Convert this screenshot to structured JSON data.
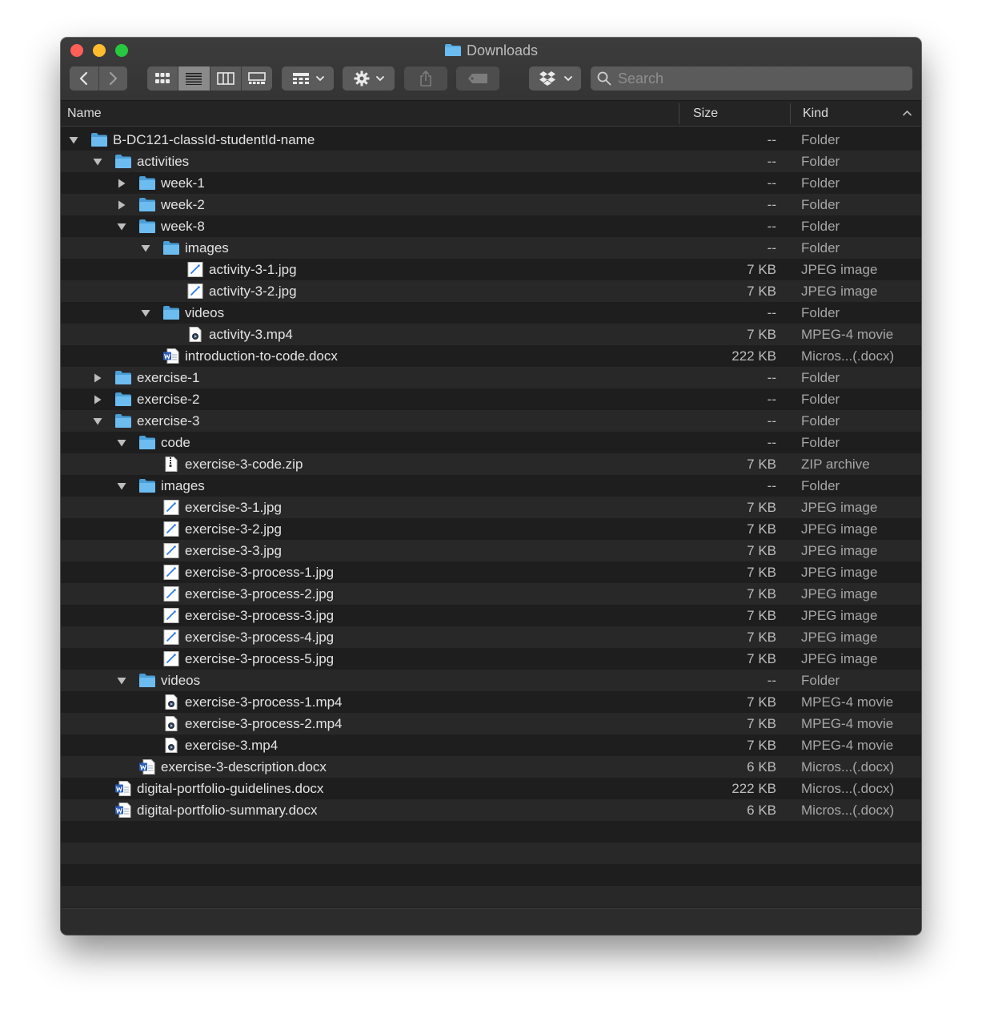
{
  "window": {
    "title": "Downloads"
  },
  "toolbar": {
    "search_placeholder": "Search"
  },
  "columns": {
    "name": "Name",
    "size": "Size",
    "kind": "Kind"
  },
  "rows": [
    {
      "name": "B-DC121-classId-studentId-name",
      "size": "--",
      "kind": "Folder",
      "depth": 0,
      "type": "folder",
      "disclosure": "expanded"
    },
    {
      "name": "activities",
      "size": "--",
      "kind": "Folder",
      "depth": 1,
      "type": "folder",
      "disclosure": "expanded"
    },
    {
      "name": "week-1",
      "size": "--",
      "kind": "Folder",
      "depth": 2,
      "type": "folder",
      "disclosure": "collapsed"
    },
    {
      "name": "week-2",
      "size": "--",
      "kind": "Folder",
      "depth": 2,
      "type": "folder",
      "disclosure": "collapsed"
    },
    {
      "name": "week-8",
      "size": "--",
      "kind": "Folder",
      "depth": 2,
      "type": "folder",
      "disclosure": "expanded"
    },
    {
      "name": "images",
      "size": "--",
      "kind": "Folder",
      "depth": 3,
      "type": "folder",
      "disclosure": "expanded"
    },
    {
      "name": "activity-3-1.jpg",
      "size": "7 KB",
      "kind": "JPEG image",
      "depth": 4,
      "type": "image"
    },
    {
      "name": "activity-3-2.jpg",
      "size": "7 KB",
      "kind": "JPEG image",
      "depth": 4,
      "type": "image"
    },
    {
      "name": "videos",
      "size": "--",
      "kind": "Folder",
      "depth": 3,
      "type": "folder",
      "disclosure": "expanded"
    },
    {
      "name": "activity-3.mp4",
      "size": "7 KB",
      "kind": "MPEG-4 movie",
      "depth": 4,
      "type": "movie"
    },
    {
      "name": "introduction-to-code.docx",
      "size": "222 KB",
      "kind": "Micros...(.docx)",
      "depth": 3,
      "type": "docx"
    },
    {
      "name": "exercise-1",
      "size": "--",
      "kind": "Folder",
      "depth": 1,
      "type": "folder",
      "disclosure": "collapsed"
    },
    {
      "name": "exercise-2",
      "size": "--",
      "kind": "Folder",
      "depth": 1,
      "type": "folder",
      "disclosure": "collapsed"
    },
    {
      "name": "exercise-3",
      "size": "--",
      "kind": "Folder",
      "depth": 1,
      "type": "folder",
      "disclosure": "expanded"
    },
    {
      "name": "code",
      "size": "--",
      "kind": "Folder",
      "depth": 2,
      "type": "folder",
      "disclosure": "expanded"
    },
    {
      "name": "exercise-3-code.zip",
      "size": "7 KB",
      "kind": "ZIP archive",
      "depth": 3,
      "type": "zip"
    },
    {
      "name": "images",
      "size": "--",
      "kind": "Folder",
      "depth": 2,
      "type": "folder",
      "disclosure": "expanded"
    },
    {
      "name": "exercise-3-1.jpg",
      "size": "7 KB",
      "kind": "JPEG image",
      "depth": 3,
      "type": "image"
    },
    {
      "name": "exercise-3-2.jpg",
      "size": "7 KB",
      "kind": "JPEG image",
      "depth": 3,
      "type": "image"
    },
    {
      "name": "exercise-3-3.jpg",
      "size": "7 KB",
      "kind": "JPEG image",
      "depth": 3,
      "type": "image"
    },
    {
      "name": "exercise-3-process-1.jpg",
      "size": "7 KB",
      "kind": "JPEG image",
      "depth": 3,
      "type": "image"
    },
    {
      "name": "exercise-3-process-2.jpg",
      "size": "7 KB",
      "kind": "JPEG image",
      "depth": 3,
      "type": "image"
    },
    {
      "name": "exercise-3-process-3.jpg",
      "size": "7 KB",
      "kind": "JPEG image",
      "depth": 3,
      "type": "image"
    },
    {
      "name": "exercise-3-process-4.jpg",
      "size": "7 KB",
      "kind": "JPEG image",
      "depth": 3,
      "type": "image"
    },
    {
      "name": "exercise-3-process-5.jpg",
      "size": "7 KB",
      "kind": "JPEG image",
      "depth": 3,
      "type": "image"
    },
    {
      "name": "videos",
      "size": "--",
      "kind": "Folder",
      "depth": 2,
      "type": "folder",
      "disclosure": "expanded"
    },
    {
      "name": "exercise-3-process-1.mp4",
      "size": "7 KB",
      "kind": "MPEG-4 movie",
      "depth": 3,
      "type": "movie"
    },
    {
      "name": "exercise-3-process-2.mp4",
      "size": "7 KB",
      "kind": "MPEG-4 movie",
      "depth": 3,
      "type": "movie"
    },
    {
      "name": "exercise-3.mp4",
      "size": "7 KB",
      "kind": "MPEG-4 movie",
      "depth": 3,
      "type": "movie"
    },
    {
      "name": "exercise-3-description.docx",
      "size": "6 KB",
      "kind": "Micros...(.docx)",
      "depth": 2,
      "type": "docx"
    },
    {
      "name": "digital-portfolio-guidelines.docx",
      "size": "222 KB",
      "kind": "Micros...(.docx)",
      "depth": 1,
      "type": "docx"
    },
    {
      "name": "digital-portfolio-summary.docx",
      "size": "6 KB",
      "kind": "Micros...(.docx)",
      "depth": 1,
      "type": "docx"
    }
  ],
  "colors": {
    "folder": "#5aaee6",
    "window_bg": "#1e1e1e",
    "row_alt": "#282828",
    "close": "#fe5f57",
    "minimize": "#febc2e",
    "zoom": "#28c840"
  }
}
